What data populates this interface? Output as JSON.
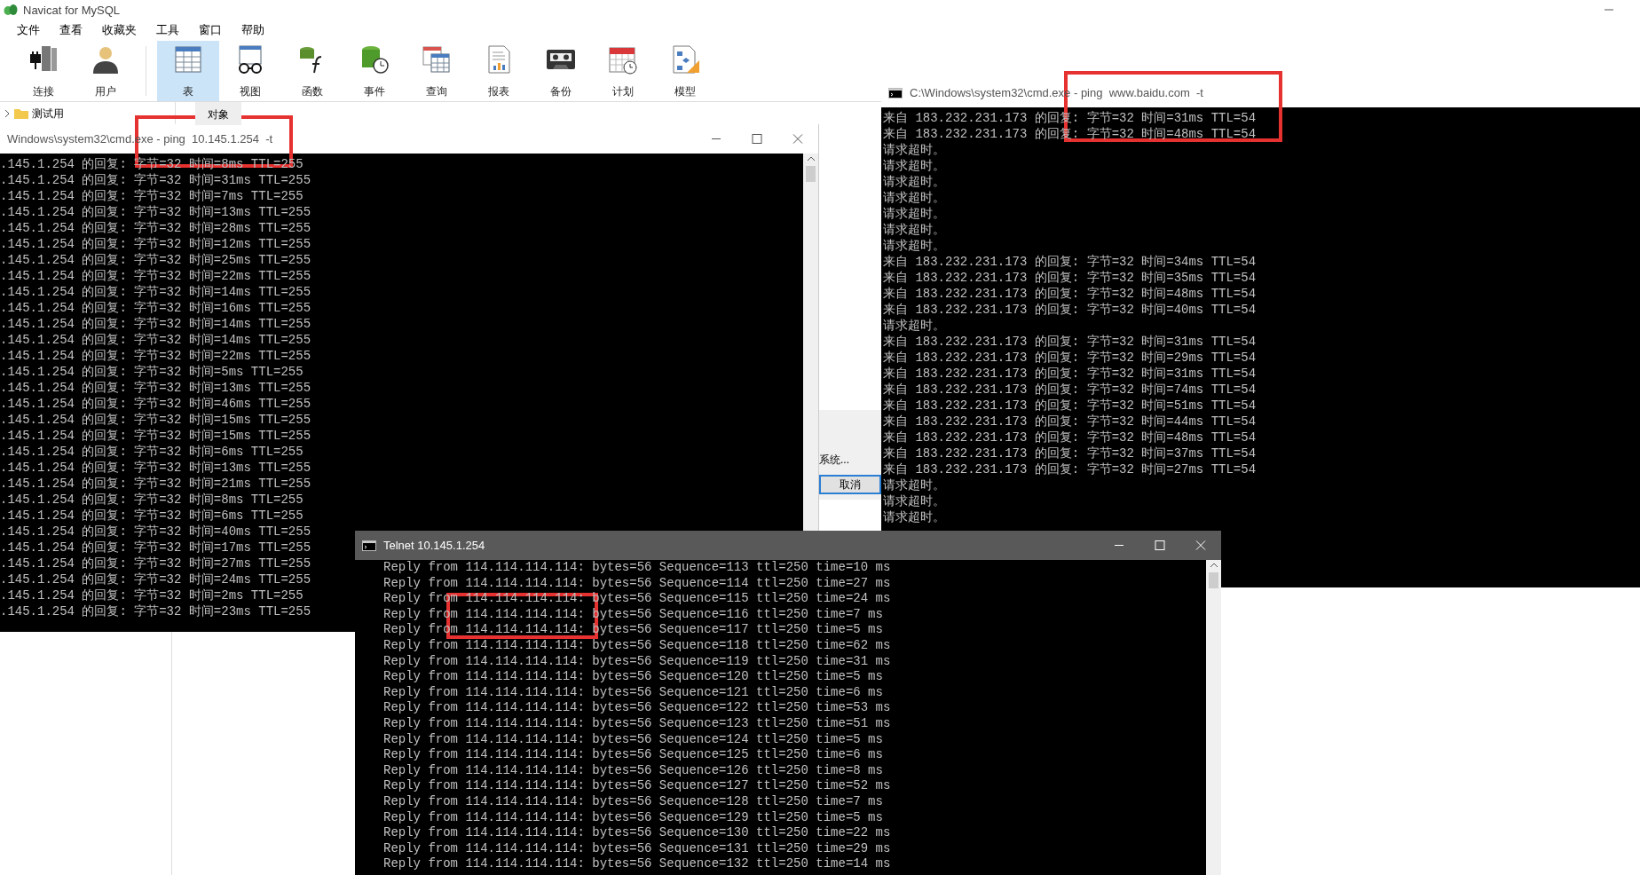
{
  "app": {
    "title": "Navicat for MySQL",
    "menu": [
      "文件",
      "查看",
      "收藏夹",
      "工具",
      "窗口",
      "帮助"
    ],
    "toolbar": [
      {
        "kind": "connect",
        "label": "连接",
        "selected": false
      },
      {
        "kind": "user",
        "label": "用户",
        "selected": false
      },
      {
        "kind": "table",
        "label": "表",
        "selected": true
      },
      {
        "kind": "view",
        "label": "视图",
        "selected": false
      },
      {
        "kind": "function",
        "label": "函数",
        "selected": false
      },
      {
        "kind": "event",
        "label": "事件",
        "selected": false
      },
      {
        "kind": "query",
        "label": "查询",
        "selected": false
      },
      {
        "kind": "report",
        "label": "报表",
        "selected": false
      },
      {
        "kind": "backup",
        "label": "备份",
        "selected": false
      },
      {
        "kind": "schedule",
        "label": "计划",
        "selected": false
      },
      {
        "kind": "model",
        "label": "模型",
        "selected": false
      }
    ],
    "tree": [
      {
        "label": "测试用",
        "expanded": false
      }
    ],
    "object_tab": "对象",
    "dialog": {
      "text": "系统...",
      "cancel_button": "取消"
    }
  },
  "ping_window": {
    "title": "Windows\\system32\\cmd.exe - ping  10.145.1.254  -t",
    "lines": [
      ".145.1.254 的回复: 字节=32 时间=8ms TTL=255",
      ".145.1.254 的回复: 字节=32 时间=31ms TTL=255",
      ".145.1.254 的回复: 字节=32 时间=7ms TTL=255",
      ".145.1.254 的回复: 字节=32 时间=13ms TTL=255",
      ".145.1.254 的回复: 字节=32 时间=28ms TTL=255",
      ".145.1.254 的回复: 字节=32 时间=12ms TTL=255",
      ".145.1.254 的回复: 字节=32 时间=25ms TTL=255",
      ".145.1.254 的回复: 字节=32 时间=22ms TTL=255",
      ".145.1.254 的回复: 字节=32 时间=14ms TTL=255",
      ".145.1.254 的回复: 字节=32 时间=16ms TTL=255",
      ".145.1.254 的回复: 字节=32 时间=14ms TTL=255",
      ".145.1.254 的回复: 字节=32 时间=14ms TTL=255",
      ".145.1.254 的回复: 字节=32 时间=22ms TTL=255",
      ".145.1.254 的回复: 字节=32 时间=5ms TTL=255",
      ".145.1.254 的回复: 字节=32 时间=13ms TTL=255",
      ".145.1.254 的回复: 字节=32 时间=46ms TTL=255",
      ".145.1.254 的回复: 字节=32 时间=15ms TTL=255",
      ".145.1.254 的回复: 字节=32 时间=15ms TTL=255",
      ".145.1.254 的回复: 字节=32 时间=6ms TTL=255",
      ".145.1.254 的回复: 字节=32 时间=13ms TTL=255",
      ".145.1.254 的回复: 字节=32 时间=21ms TTL=255",
      ".145.1.254 的回复: 字节=32 时间=8ms TTL=255",
      ".145.1.254 的回复: 字节=32 时间=6ms TTL=255",
      ".145.1.254 的回复: 字节=32 时间=40ms TTL=255",
      ".145.1.254 的回复: 字节=32 时间=17ms TTL=255",
      ".145.1.254 的回复: 字节=32 时间=27ms TTL=255",
      ".145.1.254 的回复: 字节=32 时间=24ms TTL=255",
      ".145.1.254 的回复: 字节=32 时间=2ms TTL=255",
      ".145.1.254 的回复: 字节=32 时间=23ms TTL=255"
    ]
  },
  "baidu_window": {
    "title": "C:\\Windows\\system32\\cmd.exe - ping  www.baidu.com  -t",
    "lines": [
      "来自 183.232.231.173 的回复: 字节=32 时间=31ms TTL=54",
      "来自 183.232.231.173 的回复: 字节=32 时间=48ms TTL=54",
      "请求超时。",
      "请求超时。",
      "请求超时。",
      "请求超时。",
      "请求超时。",
      "请求超时。",
      "请求超时。",
      "来自 183.232.231.173 的回复: 字节=32 时间=34ms TTL=54",
      "来自 183.232.231.173 的回复: 字节=32 时间=35ms TTL=54",
      "来自 183.232.231.173 的回复: 字节=32 时间=48ms TTL=54",
      "来自 183.232.231.173 的回复: 字节=32 时间=40ms TTL=54",
      "请求超时。",
      "来自 183.232.231.173 的回复: 字节=32 时间=31ms TTL=54",
      "来自 183.232.231.173 的回复: 字节=32 时间=29ms TTL=54",
      "来自 183.232.231.173 的回复: 字节=32 时间=31ms TTL=54",
      "来自 183.232.231.173 的回复: 字节=32 时间=74ms TTL=54",
      "来自 183.232.231.173 的回复: 字节=32 时间=51ms TTL=54",
      "来自 183.232.231.173 的回复: 字节=32 时间=44ms TTL=54",
      "来自 183.232.231.173 的回复: 字节=32 时间=48ms TTL=54",
      "来自 183.232.231.173 的回复: 字节=32 时间=37ms TTL=54",
      "来自 183.232.231.173 的回复: 字节=32 时间=27ms TTL=54",
      "请求超时。",
      "请求超时。",
      "请求超时。"
    ]
  },
  "telnet_window": {
    "title": "Telnet 10.145.1.254",
    "lines": [
      "Reply from 114.114.114.114: bytes=56 Sequence=113 ttl=250 time=10 ms",
      "Reply from 114.114.114.114: bytes=56 Sequence=114 ttl=250 time=27 ms",
      "Reply from 114.114.114.114: bytes=56 Sequence=115 ttl=250 time=24 ms",
      "Reply from 114.114.114.114: bytes=56 Sequence=116 ttl=250 time=7 ms",
      "Reply from 114.114.114.114: bytes=56 Sequence=117 ttl=250 time=5 ms",
      "Reply from 114.114.114.114: bytes=56 Sequence=118 ttl=250 time=62 ms",
      "Reply from 114.114.114.114: bytes=56 Sequence=119 ttl=250 time=31 ms",
      "Reply from 114.114.114.114: bytes=56 Sequence=120 ttl=250 time=5 ms",
      "Reply from 114.114.114.114: bytes=56 Sequence=121 ttl=250 time=6 ms",
      "Reply from 114.114.114.114: bytes=56 Sequence=122 ttl=250 time=53 ms",
      "Reply from 114.114.114.114: bytes=56 Sequence=123 ttl=250 time=51 ms",
      "Reply from 114.114.114.114: bytes=56 Sequence=124 ttl=250 time=5 ms",
      "Reply from 114.114.114.114: bytes=56 Sequence=125 ttl=250 time=6 ms",
      "Reply from 114.114.114.114: bytes=56 Sequence=126 ttl=250 time=8 ms",
      "Reply from 114.114.114.114: bytes=56 Sequence=127 ttl=250 time=52 ms",
      "Reply from 114.114.114.114: bytes=56 Sequence=128 ttl=250 time=7 ms",
      "Reply from 114.114.114.114: bytes=56 Sequence=129 ttl=250 time=5 ms",
      "Reply from 114.114.114.114: bytes=56 Sequence=130 ttl=250 time=22 ms",
      "Reply from 114.114.114.114: bytes=56 Sequence=131 ttl=250 time=29 ms",
      "Reply from 114.114.114.114: bytes=56 Sequence=132 ttl=250 time=14 ms"
    ]
  }
}
